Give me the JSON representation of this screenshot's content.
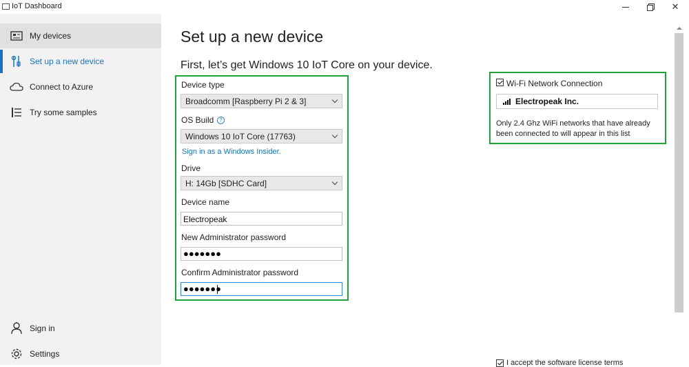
{
  "window": {
    "title": "IoT Dashboard"
  },
  "sidebar": {
    "items": [
      {
        "label": "My devices",
        "icon": "device-icon"
      },
      {
        "label": "Set up a new device",
        "icon": "tools-icon"
      },
      {
        "label": "Connect to Azure",
        "icon": "cloud-icon"
      },
      {
        "label": "Try some samples",
        "icon": "list-icon"
      }
    ],
    "bottom_items": [
      {
        "label": "Sign in",
        "icon": "person-icon"
      },
      {
        "label": "Settings",
        "icon": "gear-icon"
      }
    ]
  },
  "main": {
    "title": "Set up a new device",
    "subtitle": "First, let’s get Windows 10 IoT Core on your device.",
    "device_type": {
      "label": "Device type",
      "value": "Broadcomm [Raspberry Pi 2 & 3]"
    },
    "os_build": {
      "label": "OS Build",
      "value": "Windows 10 IoT Core (17763)",
      "help": "?"
    },
    "insider_link": "Sign in as a Windows Insider.",
    "drive": {
      "label": "Drive",
      "value": "H: 14Gb [SDHC Card]"
    },
    "device_name": {
      "label": "Device name",
      "value": "Electropeak"
    },
    "new_password": {
      "label": "New Administrator password",
      "value": "●●●●●●●"
    },
    "confirm_password": {
      "label": "Confirm Administrator password",
      "value": "●●●●●●●"
    }
  },
  "wifi": {
    "checkbox_label": "Wi-Fi Network Connection",
    "checked": true,
    "network_name": "Electropeak Inc.",
    "note": "Only 2.4 Ghz WiFi networks that have already been connected to will appear in this list"
  },
  "license": {
    "label": "I accept the software license terms",
    "checked": true
  },
  "colors": {
    "accent": "#1a73c9",
    "highlight": "#1fa33a",
    "sidebar_bg": "#f2f2f2"
  }
}
